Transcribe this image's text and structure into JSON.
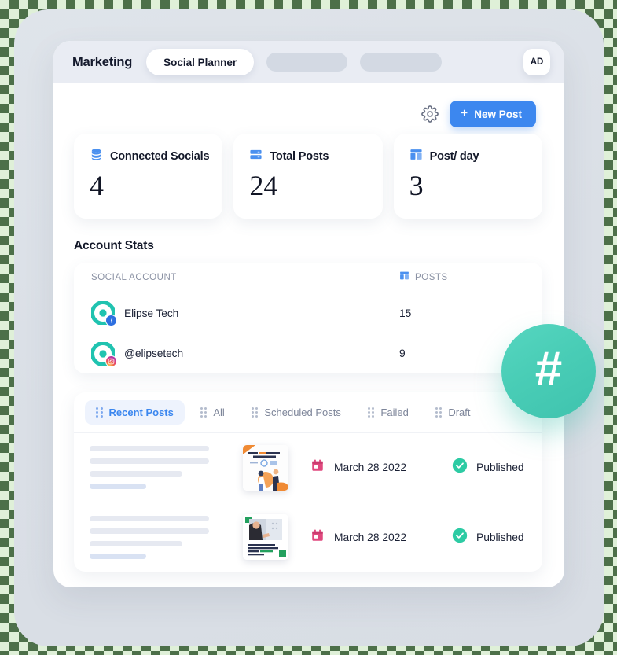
{
  "topbar": {
    "brand": "Marketing",
    "active_tab": "Social Planner",
    "ghost_tabs": [
      "",
      ""
    ],
    "avatar_initials": "AD"
  },
  "actions": {
    "settings_icon": "gear-icon",
    "new_post_label": "New Post",
    "new_post_plus": "+"
  },
  "stats": [
    {
      "icon": "database-icon",
      "label": "Connected Socials",
      "value": "4"
    },
    {
      "icon": "server-icon",
      "label": "Total Posts",
      "value": "24"
    },
    {
      "icon": "layout-icon",
      "label": "Post/ day",
      "value": "3"
    }
  ],
  "account_stats": {
    "title": "Account Stats",
    "columns": {
      "account": "SOCIAL ACCOUNT",
      "posts": "POSTS",
      "posts_icon": "layout-icon"
    },
    "rows": [
      {
        "name": "Elipse Tech",
        "network": "facebook",
        "posts": "15"
      },
      {
        "name": "@elipsetech",
        "network": "instagram",
        "posts": "9"
      }
    ]
  },
  "posts_panel": {
    "tabs": [
      {
        "label": "Recent Posts",
        "active": true
      },
      {
        "label": "All",
        "active": false
      },
      {
        "label": "Scheduled Posts",
        "active": false
      },
      {
        "label": "Failed",
        "active": false
      },
      {
        "label": "Draft",
        "active": false
      }
    ],
    "rows": [
      {
        "thumbnail": "high-value-content-thumbnail",
        "thumbnail_title": "High Value Content Drives Results",
        "date": "March 28 2022",
        "status": "Published",
        "status_color": "#2dcba4"
      },
      {
        "thumbnail": "safety-first-thumbnail",
        "thumbnail_title": "Did you know the cost of your business is 5x faster than safety training?",
        "date": "March 28 2022",
        "status": "Published",
        "status_color": "#2dcba4"
      }
    ]
  },
  "floating_badge": {
    "glyph": "#",
    "color": "#49cdb6"
  },
  "theme": {
    "accent_blue": "#3c87ef",
    "accent_teal": "#2dcba4",
    "calendar_pink": "#e0487e",
    "avatar_teal": "#20c3b0"
  }
}
